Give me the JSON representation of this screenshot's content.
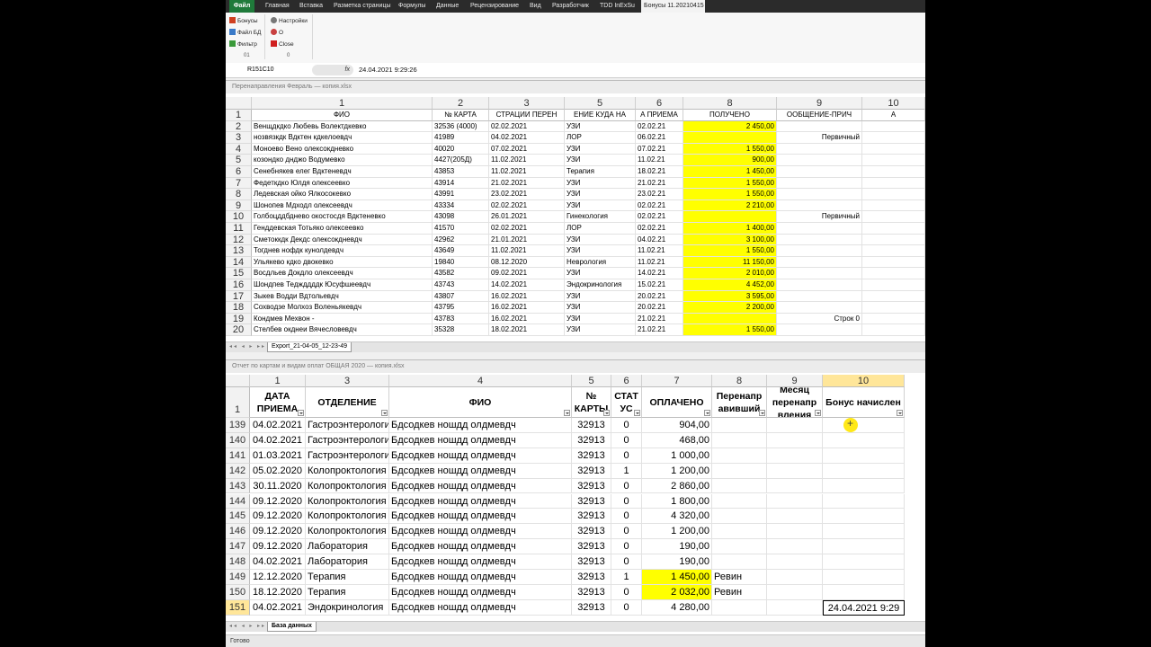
{
  "ribbon": {
    "tabs": [
      "Файл",
      "Главная",
      "Вставка",
      "Разметка страницы",
      "Формулы",
      "Данные",
      "Рецензирование",
      "Вид",
      "Разработчик",
      "TDD InExSu",
      "Бонусы 11.20210415"
    ],
    "group1": {
      "buttons": [
        "Бонусы",
        "Файл БД",
        "Фильтр"
      ],
      "label": "01"
    },
    "group2": {
      "buttons": [
        "Настройки",
        "O",
        "Close"
      ],
      "label": "0"
    }
  },
  "formula_bar": {
    "name_box": "R151C10",
    "fx": "fx",
    "formula": "24.04.2021  9:29:26"
  },
  "top_window": {
    "title": "Перенаправления Февраль — копия.xlsx",
    "col_headers": [
      "1",
      "2",
      "3",
      "5",
      "6",
      "8",
      "9",
      "10"
    ],
    "table_headers": [
      "ФИО",
      "№ КАРТА",
      "СТРАЦИИ ПЕРЕН",
      "ЕНИЕ КУДА НА",
      "А ПРИЕМА",
      "ПОЛУЧЕНО",
      "ООБЩЕНИЕ-ПРИЧ",
      "А"
    ],
    "rows": [
      {
        "n": "2",
        "fio": "Венщдкдко Любевь Волектдкевко",
        "card": "32536 (4000)",
        "d1": "02.02.2021",
        "to": "УЗИ",
        "d2": "02.02.21",
        "amt": "2 450,00",
        "msg": ""
      },
      {
        "n": "3",
        "fio": "нозвязкдк Вдктен кдкелоевдч",
        "card": "41989",
        "d1": "04.02.2021",
        "to": "ЛОР",
        "d2": "06.02.21",
        "amt": "",
        "msg": "Первичный"
      },
      {
        "n": "4",
        "fio": "Моноево Вено олексокдневко",
        "card": "40020",
        "d1": "07.02.2021",
        "to": "УЗИ",
        "d2": "07.02.21",
        "amt": "1 550,00",
        "msg": ""
      },
      {
        "n": "5",
        "fio": "козондко днджо Водумевко",
        "card": "4427(205Д)",
        "d1": "11.02.2021",
        "to": "УЗИ",
        "d2": "11.02.21",
        "amt": "900,00",
        "msg": ""
      },
      {
        "n": "6",
        "fio": "Сенебнякев елег Вдктеневдч",
        "card": "43853",
        "d1": "11.02.2021",
        "to": "Терапия",
        "d2": "18.02.21",
        "amt": "1 450,00",
        "msg": ""
      },
      {
        "n": "7",
        "fio": "Федеткдко Юлдя олексеевко",
        "card": "43914",
        "d1": "21.02.2021",
        "to": "УЗИ",
        "d2": "21.02.21",
        "amt": "1 550,00",
        "msg": ""
      },
      {
        "n": "8",
        "fio": "Ледевская ойко Ялкосокевко",
        "card": "43991",
        "d1": "23.02.2021",
        "to": "УЗИ",
        "d2": "23.02.21",
        "amt": "1 550,00",
        "msg": ""
      },
      {
        "n": "9",
        "fio": "Шонопев Мдходл олексеевдч",
        "card": "43334",
        "d1": "02.02.2021",
        "to": "УЗИ",
        "d2": "02.02.21",
        "amt": "2 210,00",
        "msg": ""
      },
      {
        "n": "10",
        "fio": "Голбоцддбднево окостосдя Вдктеневко",
        "card": "43098",
        "d1": "26.01.2021",
        "to": "Гинекология",
        "d2": "02.02.21",
        "amt": "",
        "msg": "Первичный"
      },
      {
        "n": "11",
        "fio": "Генддевская Тотьяко олексеевко",
        "card": "41570",
        "d1": "02.02.2021",
        "to": "ЛОР",
        "d2": "02.02.21",
        "amt": "1 400,00",
        "msg": ""
      },
      {
        "n": "12",
        "fio": "Сметоккдк Декдс олексокдневдч",
        "card": "42962",
        "d1": "21.01.2021",
        "to": "УЗИ",
        "d2": "04.02.21",
        "amt": "3 100,00",
        "msg": ""
      },
      {
        "n": "13",
        "fio": "Тогднев нофдк кунолдевдч",
        "card": "43649",
        "d1": "11.02.2021",
        "to": "УЗИ",
        "d2": "11.02.21",
        "amt": "1 550,00",
        "msg": ""
      },
      {
        "n": "14",
        "fio": "Ульякево кдко двокевко",
        "card": "19840",
        "d1": "08.12.2020",
        "to": "Неврология",
        "d2": "11.02.21",
        "amt": "11 150,00",
        "msg": ""
      },
      {
        "n": "15",
        "fio": "Восдльев Докдло олексеевдч",
        "card": "43582",
        "d1": "09.02.2021",
        "to": "УЗИ",
        "d2": "14.02.21",
        "amt": "2 010,00",
        "msg": ""
      },
      {
        "n": "16",
        "fio": "Шондпев Теджддддк Юсуфшеевдч",
        "card": "43743",
        "d1": "14.02.2021",
        "to": "Эндокринология",
        "d2": "15.02.21",
        "amt": "4 452,00",
        "msg": ""
      },
      {
        "n": "17",
        "fio": "Зыкев Водди Вдтольевдч",
        "card": "43807",
        "d1": "16.02.2021",
        "to": "УЗИ",
        "d2": "20.02.21",
        "amt": "3 595,00",
        "msg": ""
      },
      {
        "n": "18",
        "fio": "Сохводзе Молхоз Воленьякевдч",
        "card": "43795",
        "d1": "16.02.2021",
        "to": "УЗИ",
        "d2": "20.02.21",
        "amt": "2 200,00",
        "msg": ""
      },
      {
        "n": "19",
        "fio": "Кондмев Мехвон -",
        "card": "43783",
        "d1": "16.02.2021",
        "to": "УЗИ",
        "d2": "21.02.21",
        "amt": "",
        "msg": "Строк 0"
      },
      {
        "n": "20",
        "fio": "Стелбев окднеи Вячесловевдч",
        "card": "35328",
        "d1": "18.02.2021",
        "to": "УЗИ",
        "d2": "21.02.21",
        "amt": "1 550,00",
        "msg": ""
      }
    ],
    "sheet_tab": "Export_21-04-05_12-23-49"
  },
  "bottom_window": {
    "title": "Отчет по картам и видам оплат ОБЩАЯ 2020 — копия.xlsx",
    "col_headers": [
      "1",
      "3",
      "4",
      "5",
      "6",
      "7",
      "8",
      "9",
      "10"
    ],
    "header_row_num": "1",
    "table_headers": [
      "ДАТА ПРИЕМА",
      "ОТДЕЛЕНИЕ",
      "ФИО",
      "№ КАРТЫ",
      "СТАТ УС",
      "ОПЛАЧЕНО",
      "Перенапр авивший",
      "Месяц перенапр вления",
      "Бонус начислен"
    ],
    "rows": [
      {
        "n": "139",
        "date": "04.02.2021",
        "dept": "Гастроэнтерология",
        "fio": "Бдсодкев ношдд олдмевдч",
        "card": "32913",
        "st": "0",
        "paid": "904,00",
        "by": "",
        "bonus": ""
      },
      {
        "n": "140",
        "date": "04.02.2021",
        "dept": "Гастроэнтерология",
        "fio": "Бдсодкев ношдд олдмевдч",
        "card": "32913",
        "st": "0",
        "paid": "468,00",
        "by": "",
        "bonus": ""
      },
      {
        "n": "141",
        "date": "01.03.2021",
        "dept": "Гастроэнтерология",
        "fio": "Бдсодкев ношдд олдмевдч",
        "card": "32913",
        "st": "0",
        "paid": "1 000,00",
        "by": "",
        "bonus": ""
      },
      {
        "n": "142",
        "date": "05.02.2020",
        "dept": "Колопроктология",
        "fio": "Бдсодкев ношдд олдмевдч",
        "card": "32913",
        "st": "1",
        "paid": "1 200,00",
        "by": "",
        "bonus": ""
      },
      {
        "n": "143",
        "date": "30.11.2020",
        "dept": "Колопроктология",
        "fio": "Бдсодкев ношдд олдмевдч",
        "card": "32913",
        "st": "0",
        "paid": "2 860,00",
        "by": "",
        "bonus": ""
      },
      {
        "n": "144",
        "date": "09.12.2020",
        "dept": "Колопроктология",
        "fio": "Бдсодкев ношдд олдмевдч",
        "card": "32913",
        "st": "0",
        "paid": "1 800,00",
        "by": "",
        "bonus": ""
      },
      {
        "n": "145",
        "date": "09.12.2020",
        "dept": "Колопроктология",
        "fio": "Бдсодкев ношдд олдмевдч",
        "card": "32913",
        "st": "0",
        "paid": "4 320,00",
        "by": "",
        "bonus": ""
      },
      {
        "n": "146",
        "date": "09.12.2020",
        "dept": "Колопроктология",
        "fio": "Бдсодкев ношдд олдмевдч",
        "card": "32913",
        "st": "0",
        "paid": "1 200,00",
        "by": "",
        "bonus": ""
      },
      {
        "n": "147",
        "date": "09.12.2020",
        "dept": "Лаборатория",
        "fio": "Бдсодкев ношдд олдмевдч",
        "card": "32913",
        "st": "0",
        "paid": "190,00",
        "by": "",
        "bonus": ""
      },
      {
        "n": "148",
        "date": "04.02.2021",
        "dept": "Лаборатория",
        "fio": "Бдсодкев ношдд олдмевдч",
        "card": "32913",
        "st": "0",
        "paid": "190,00",
        "by": "",
        "bonus": ""
      },
      {
        "n": "149",
        "date": "12.12.2020",
        "dept": "Терапия",
        "fio": "Бдсодкев ношдд олдмевдч",
        "card": "32913",
        "st": "1",
        "paid": "1 450,00",
        "by": "Ревин",
        "bonus": ""
      },
      {
        "n": "150",
        "date": "18.12.2020",
        "dept": "Терапия",
        "fio": "Бдсодкев ношдд олдмевдч",
        "card": "32913",
        "st": "0",
        "paid": "2 032,00",
        "by": "Ревин",
        "bonus": ""
      },
      {
        "n": "151",
        "date": "04.02.2021",
        "dept": "Эндокринология",
        "fio": "Бдсодкев ношдд олдмевдч",
        "card": "32913",
        "st": "0",
        "paid": "4 280,00",
        "by": "",
        "bonus": "24.04.2021 9:29"
      }
    ],
    "sheet_tab": "База данных"
  },
  "status": {
    "text": "Готово"
  },
  "colors": {
    "highlight": "#ffff00",
    "ribbon_dark": "#2b2b2b",
    "file_tab": "#1f7a3a",
    "active_col": "#ffe699"
  }
}
